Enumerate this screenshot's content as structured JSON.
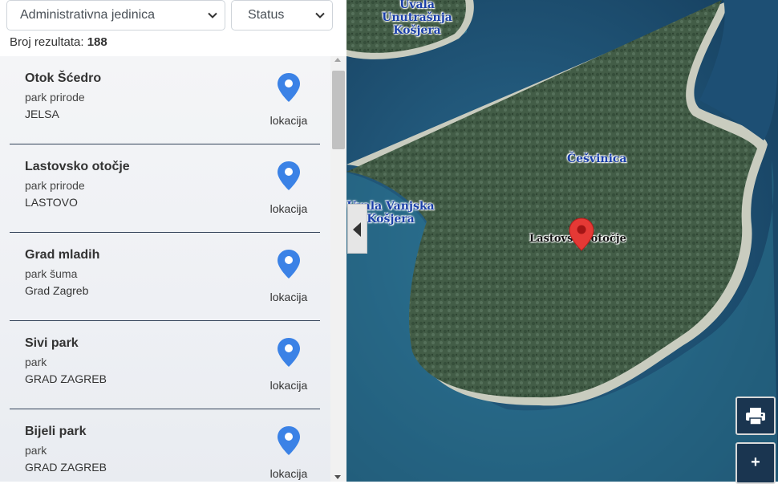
{
  "filters": {
    "admin_unit": "Administrativna jedinica",
    "status": "Status"
  },
  "results": {
    "label": "Broj rezultata:",
    "count": "188"
  },
  "items": [
    {
      "name": "Otok Šćedro",
      "type": "park prirode",
      "place": "JELSA",
      "action": "lokacija"
    },
    {
      "name": "Lastovsko otočje",
      "type": "park prirode",
      "place": "LASTOVO",
      "action": "lokacija"
    },
    {
      "name": "Grad mladih",
      "type": "park šuma",
      "place": "Grad Zagreb",
      "action": "lokacija"
    },
    {
      "name": "Sivi park",
      "type": "park",
      "place": "GRAD ZAGREB",
      "action": "lokacija"
    },
    {
      "name": "Bijeli park",
      "type": "park",
      "place": "GRAD ZAGREB",
      "action": "lokacija"
    }
  ],
  "map": {
    "labels": {
      "unutrasnja_1": "Uvala",
      "unutrasnja_2": "Unutrašnja",
      "unutrasnja_3": "Košjera",
      "cesvinica": "Češvinica",
      "vanjska_1": "Uvala Vanjska",
      "vanjska_2": "Košjera",
      "lastovsko": "Lastovsko otočje"
    },
    "controls": {
      "zoom_in": "+"
    }
  },
  "colors": {
    "pin_blue": "#3b82e6",
    "marker_red": "#e53935",
    "sea": "#1d4f74",
    "land": "#3f5a44",
    "control_bg": "#1a3550"
  }
}
